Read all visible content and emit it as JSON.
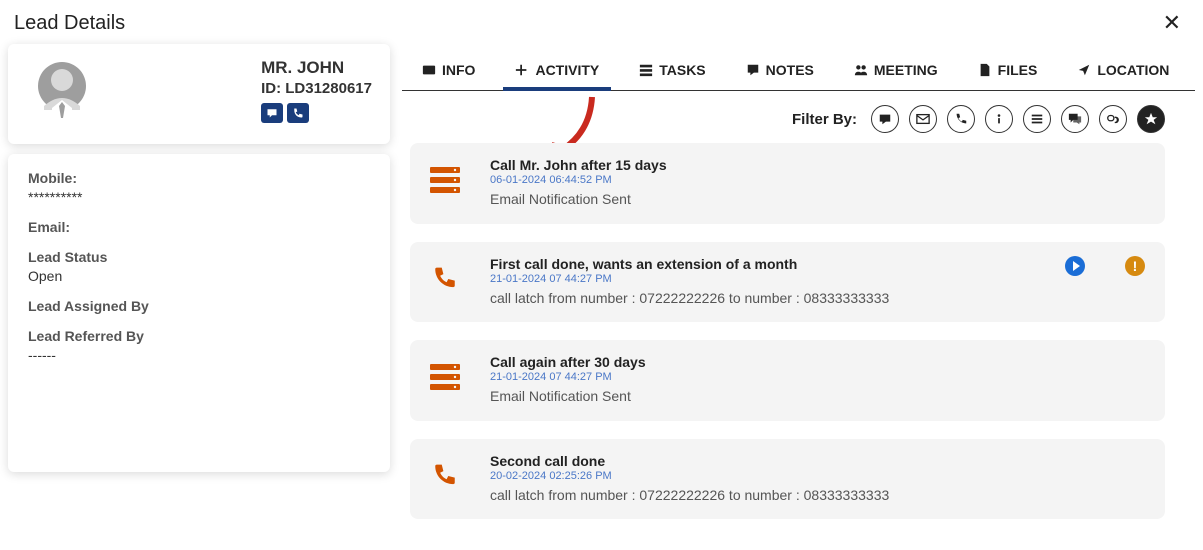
{
  "page": {
    "title": "Lead Details"
  },
  "lead": {
    "name": "MR. JOHN",
    "id_label": "ID: LD31280617"
  },
  "fields": {
    "mobile_label": "Mobile:",
    "mobile_value": "**********",
    "email_label": "Email:",
    "email_value": "",
    "status_label": "Lead Status",
    "status_value": "Open",
    "assigned_label": "Lead Assigned By",
    "assigned_value": "",
    "referred_label": "Lead Referred By",
    "referred_value": "------"
  },
  "tabs": {
    "info": "INFO",
    "activity": "ACTIVITY",
    "tasks": "TASKS",
    "notes": "NOTES",
    "meeting": "MEETING",
    "files": "FILES",
    "location": "LOCATION"
  },
  "filter": {
    "label": "Filter By:"
  },
  "activities": [
    {
      "icon": "server",
      "title": "Call Mr. John after 15 days",
      "time": "06-01-2024 06:44:52 PM",
      "desc": "Email Notification Sent"
    },
    {
      "icon": "phone",
      "title": "First call done, wants an extension of a month",
      "time": "21-01-2024 07 44:27 PM",
      "desc": "call latch from number : 07222222226 to number : 08333333333",
      "play": true,
      "warn": true
    },
    {
      "icon": "server",
      "title": "Call again after 30 days",
      "time": "21-01-2024 07 44:27 PM",
      "desc": "Email Notification Sent"
    },
    {
      "icon": "phone",
      "title": "Second call done",
      "time": "20-02-2024 02:25:26 PM",
      "desc": "call latch from number : 07222222226 to number : 08333333333"
    }
  ]
}
